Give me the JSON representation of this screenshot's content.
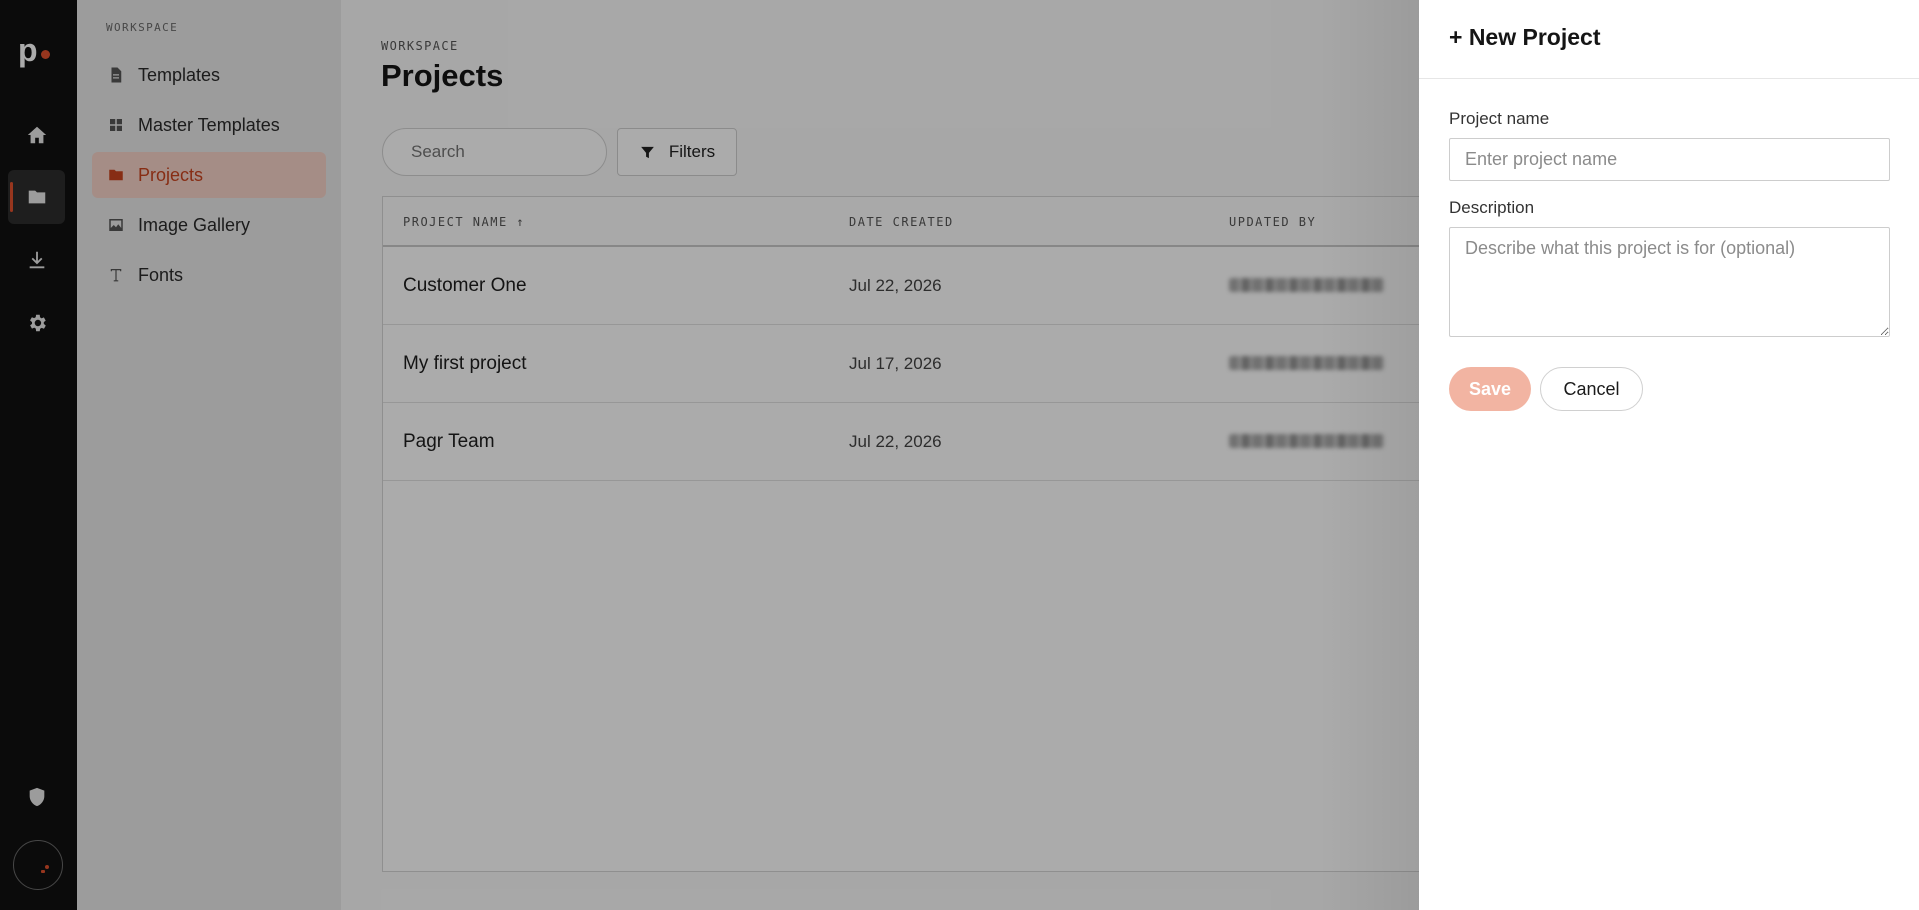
{
  "brand": {
    "logo_letter": "p",
    "accent": "#e2512e",
    "accent_dark": "#c9441f"
  },
  "rail": {
    "items": [
      {
        "name": "home-icon"
      },
      {
        "name": "folder-icon",
        "active": true
      },
      {
        "name": "download-icon"
      },
      {
        "name": "gear-icon"
      }
    ],
    "bottom": [
      {
        "name": "shield-icon"
      },
      {
        "name": "avatar"
      }
    ]
  },
  "sidebar": {
    "section_label": "WORKSPACE",
    "items": [
      {
        "label": "Templates",
        "icon": "document-icon"
      },
      {
        "label": "Master Templates",
        "icon": "grid-icon"
      },
      {
        "label": "Projects",
        "icon": "folder-icon",
        "active": true
      },
      {
        "label": "Image Gallery",
        "icon": "image-icon"
      },
      {
        "label": "Fonts",
        "icon": "type-icon"
      }
    ]
  },
  "main": {
    "breadcrumb": "WORKSPACE",
    "title": "Projects",
    "search_placeholder": "Search",
    "filters_label": "Filters",
    "columns": [
      "PROJECT NAME ↑",
      "DATE CREATED",
      "UPDATED BY"
    ],
    "rows": [
      {
        "name": "Customer One",
        "date": "Jul 22, 2026"
      },
      {
        "name": "My first project",
        "date": "Jul 17, 2026"
      },
      {
        "name": "Pagr Team",
        "date": "Jul 22, 2026"
      }
    ]
  },
  "drawer": {
    "title": "+ New Project",
    "name_label": "Project name",
    "name_placeholder": "Enter project name",
    "description_label": "Description",
    "description_placeholder": "Describe what this project is for (optional)",
    "save_label": "Save",
    "cancel_label": "Cancel"
  }
}
